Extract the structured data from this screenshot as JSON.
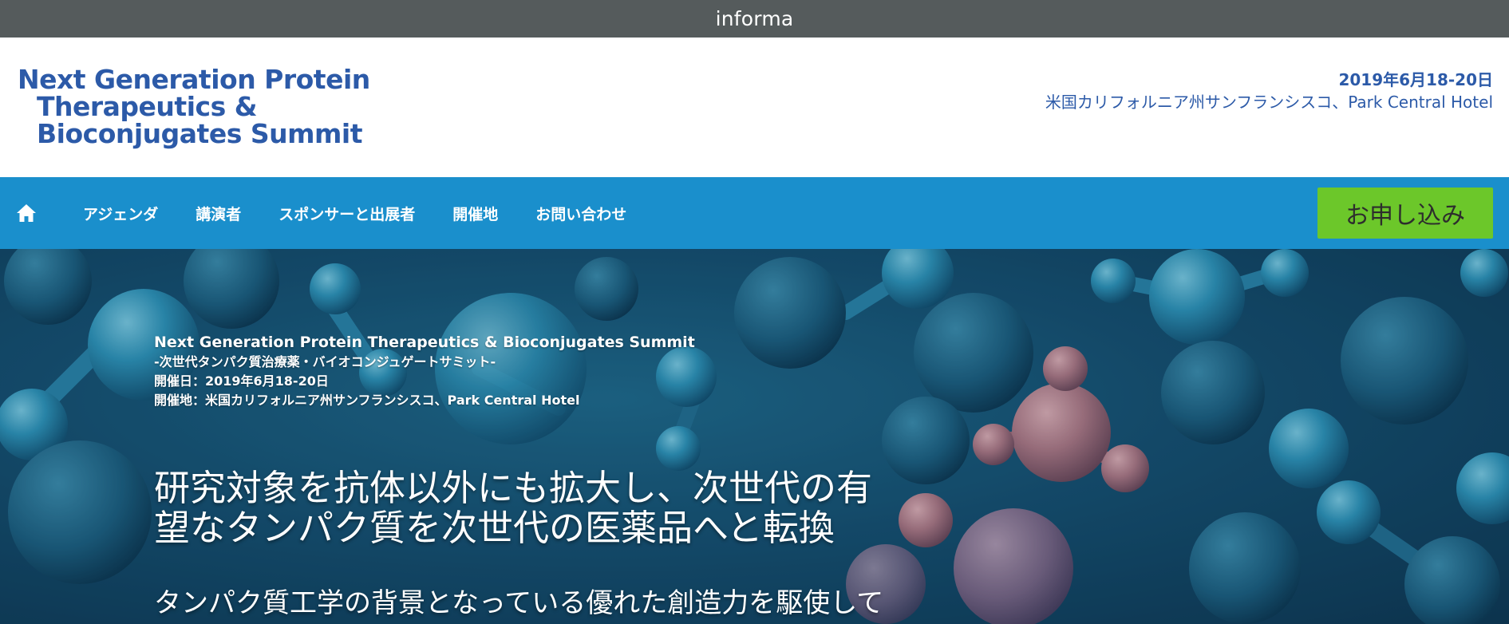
{
  "topbar": {
    "brand": "informa"
  },
  "header": {
    "logo_lines": [
      "Next Generation Protein",
      "Therapeutics &",
      "Bioconjugates Summit"
    ],
    "event_date": "2019年6月18-20日",
    "event_venue": "米国カリフォルニア州サンフランシスコ、Park Central Hotel"
  },
  "nav": {
    "home_icon": "home-icon",
    "items": [
      {
        "label": "アジェンダ"
      },
      {
        "label": "講演者"
      },
      {
        "label": "スポンサーと出展者"
      },
      {
        "label": "開催地"
      },
      {
        "label": "お問い合わせ"
      }
    ],
    "apply_label": "お申し込み"
  },
  "hero": {
    "title": "Next Generation Protein Therapeutics & Bioconjugates Summit",
    "subtitle": "-次世代タンパク質治療薬・バイオコンジュゲートサミット-",
    "date_line": "開催日：2019年6月18-20日",
    "venue_line": "開催地：米国カリフォルニア州サンフランシスコ、Park Central Hotel",
    "headline_lines": [
      "研究対象を抗体以外にも拡大し、次世代の有",
      "望なタンパク質を次世代の医薬品へと転換"
    ],
    "subline": "タンパク質工学の背景となっている優れた創造力を駆使して"
  },
  "colors": {
    "topbar": "#555b5c",
    "brand_blue": "#2c5aa8",
    "nav_blue": "#1a8fcc",
    "apply_green": "#6cc72a"
  }
}
